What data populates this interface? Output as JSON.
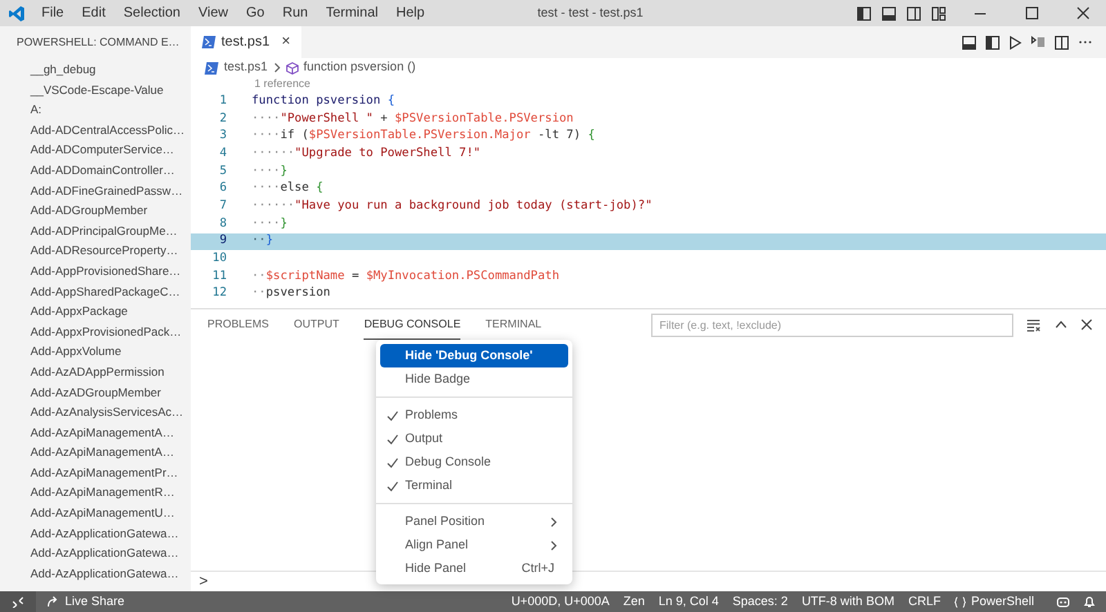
{
  "window": {
    "title": "test - test - test.ps1",
    "menu": [
      "File",
      "Edit",
      "Selection",
      "View",
      "Go",
      "Run",
      "Terminal",
      "Help"
    ]
  },
  "sidebar": {
    "title": "POWERSHELL: COMMAND E…",
    "items": [
      "__gh_debug",
      "__VSCode-Escape-Value",
      "A:",
      "Add-ADCentralAccessPolic…",
      "Add-ADComputerService…",
      "Add-ADDomainController…",
      "Add-ADFineGrainedPassw…",
      "Add-ADGroupMember",
      "Add-ADPrincipalGroupMe…",
      "Add-ADResourceProperty…",
      "Add-AppProvisionedShare…",
      "Add-AppSharedPackageC…",
      "Add-AppxPackage",
      "Add-AppxProvisionedPack…",
      "Add-AppxVolume",
      "Add-AzADAppPermission",
      "Add-AzADGroupMember",
      "Add-AzAnalysisServicesAc…",
      "Add-AzApiManagementA…",
      "Add-AzApiManagementA…",
      "Add-AzApiManagementPr…",
      "Add-AzApiManagementR…",
      "Add-AzApiManagementU…",
      "Add-AzApplicationGatewa…",
      "Add-AzApplicationGatewa…",
      "Add-AzApplicationGatewa…"
    ]
  },
  "editor": {
    "tab": {
      "label": "test.ps1",
      "close": "×"
    },
    "breadcrumb": [
      "test.ps1",
      "function psversion ()"
    ],
    "codelens": "1 reference",
    "lines": [
      {
        "number": "1",
        "current": false,
        "tokens": [
          {
            "kind": "keyword",
            "text": "function psversion "
          },
          {
            "kind": "bracket",
            "text": "{"
          }
        ]
      },
      {
        "number": "2",
        "current": false,
        "tokens": [
          {
            "kind": "ws",
            "text": "····"
          },
          {
            "kind": "string",
            "text": "\"PowerShell \""
          },
          {
            "kind": "plain",
            "text": " + "
          },
          {
            "kind": "var",
            "text": "$PSVersionTable.PSVersion"
          }
        ]
      },
      {
        "number": "3",
        "current": false,
        "tokens": [
          {
            "kind": "ws",
            "text": "····"
          },
          {
            "kind": "plain",
            "text": "if ("
          },
          {
            "kind": "var",
            "text": "$PSVersionTable.PSVersion.Major"
          },
          {
            "kind": "plain",
            "text": " -lt 7) "
          },
          {
            "kind": "bracket2",
            "text": "{"
          }
        ]
      },
      {
        "number": "4",
        "current": false,
        "tokens": [
          {
            "kind": "ws",
            "text": "······"
          },
          {
            "kind": "string",
            "text": "\"Upgrade to PowerShell 7!\""
          }
        ]
      },
      {
        "number": "5",
        "current": false,
        "tokens": [
          {
            "kind": "ws",
            "text": "····"
          },
          {
            "kind": "bracket2",
            "text": "}"
          }
        ]
      },
      {
        "number": "6",
        "current": false,
        "tokens": [
          {
            "kind": "ws",
            "text": "····"
          },
          {
            "kind": "plain",
            "text": "else "
          },
          {
            "kind": "bracket2",
            "text": "{"
          }
        ]
      },
      {
        "number": "7",
        "current": false,
        "tokens": [
          {
            "kind": "ws",
            "text": "······"
          },
          {
            "kind": "string",
            "text": "\"Have you run a background job today (start-job)?\""
          }
        ]
      },
      {
        "number": "8",
        "current": false,
        "tokens": [
          {
            "kind": "ws",
            "text": "····"
          },
          {
            "kind": "bracket2",
            "text": "}"
          }
        ]
      },
      {
        "number": "9",
        "current": true,
        "tokens": [
          {
            "kind": "ws",
            "text": "··"
          },
          {
            "kind": "bracket",
            "text": "}"
          }
        ]
      },
      {
        "number": "10",
        "current": false
      },
      {
        "number": "11",
        "current": false,
        "tokens": [
          {
            "kind": "ws",
            "text": "··"
          },
          {
            "kind": "var",
            "text": "$scriptName"
          },
          {
            "kind": "plain",
            "text": " = "
          },
          {
            "kind": "var",
            "text": "$MyInvocation.PSCommandPath"
          }
        ]
      },
      {
        "number": "12",
        "current": false,
        "tokens": [
          {
            "kind": "ws",
            "text": "··"
          },
          {
            "kind": "plain",
            "text": "psversion"
          }
        ]
      }
    ]
  },
  "panel": {
    "tabs": [
      {
        "label": "PROBLEMS",
        "selected": false
      },
      {
        "label": "OUTPUT",
        "selected": false
      },
      {
        "label": "DEBUG CONSOLE",
        "selected": true
      },
      {
        "label": "TERMINAL",
        "selected": false
      }
    ],
    "filter": {
      "placeholder": "Filter (e.g. text, !exclude)"
    },
    "prompt": ">"
  },
  "context_menu": [
    [
      {
        "kind": "action",
        "label": "Hide 'Debug Console'",
        "selected": true
      },
      {
        "kind": "action",
        "label": "Hide Badge",
        "selected": false
      }
    ],
    [
      {
        "kind": "toggle",
        "label": "Problems",
        "checked": true,
        "selected": false
      },
      {
        "kind": "toggle",
        "label": "Output",
        "checked": true,
        "selected": false
      },
      {
        "kind": "toggle",
        "label": "Debug Console",
        "checked": true,
        "selected": false
      },
      {
        "kind": "toggle",
        "label": "Terminal",
        "checked": true,
        "selected": false
      }
    ],
    [
      {
        "kind": "submenu",
        "label": "Panel Position",
        "selected": false
      },
      {
        "kind": "submenu",
        "label": "Align Panel",
        "selected": false
      },
      {
        "kind": "action",
        "label": "Hide Panel",
        "shortcut": "Ctrl+J",
        "selected": false
      }
    ]
  ],
  "status_bar": {
    "left": [
      "Live Share"
    ],
    "right": [
      "U+000D, U+000A",
      "Zen",
      "Ln 9, Col 4",
      "Spaces: 2",
      "UTF-8 with BOM",
      "CRLF",
      "PowerShell"
    ]
  }
}
